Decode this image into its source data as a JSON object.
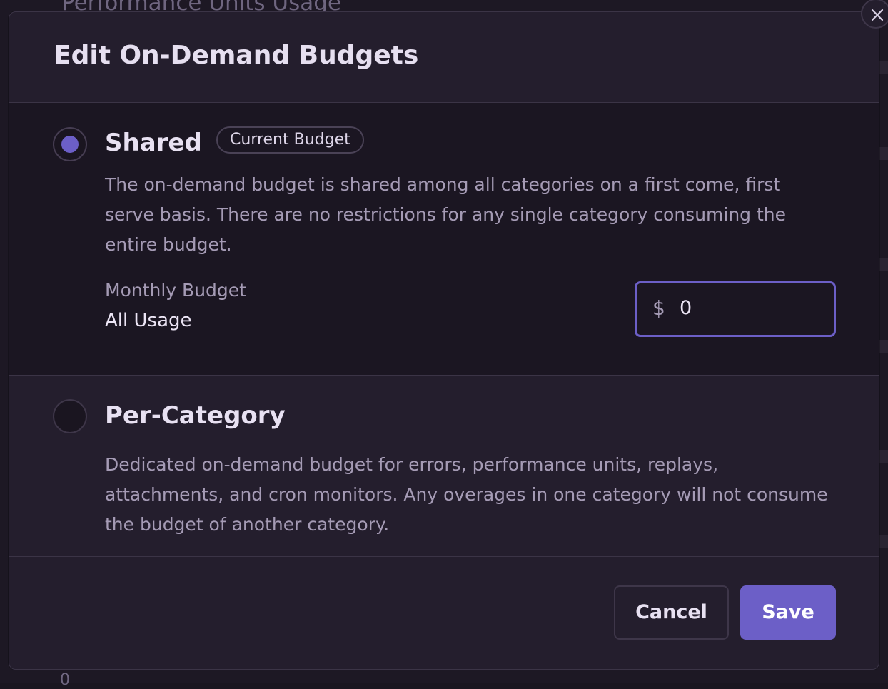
{
  "background": {
    "title": "Performance Units Usage",
    "bottom_text": "0"
  },
  "modal": {
    "title": "Edit On-Demand Budgets",
    "close_icon": "close-icon"
  },
  "options": {
    "shared": {
      "selected": true,
      "title": "Shared",
      "badge": "Current Budget",
      "description": "The on-demand budget is shared among all categories on a first come, first serve basis. There are no restrictions for any single category consuming the entire budget.",
      "budget_label": "Monthly Budget",
      "budget_scope": "All Usage",
      "currency_symbol": "$",
      "amount": "0"
    },
    "per_category": {
      "selected": false,
      "title": "Per-Category",
      "description": "Dedicated on-demand budget for errors, performance units, replays, attachments, and cron monitors. Any overages in one category will not consume the budget of another category."
    }
  },
  "footer": {
    "cancel_label": "Cancel",
    "save_label": "Save"
  },
  "colors": {
    "accent": "#6c5fc7",
    "modal_bg": "#241e2d",
    "selected_option_bg": "#1b1622"
  }
}
